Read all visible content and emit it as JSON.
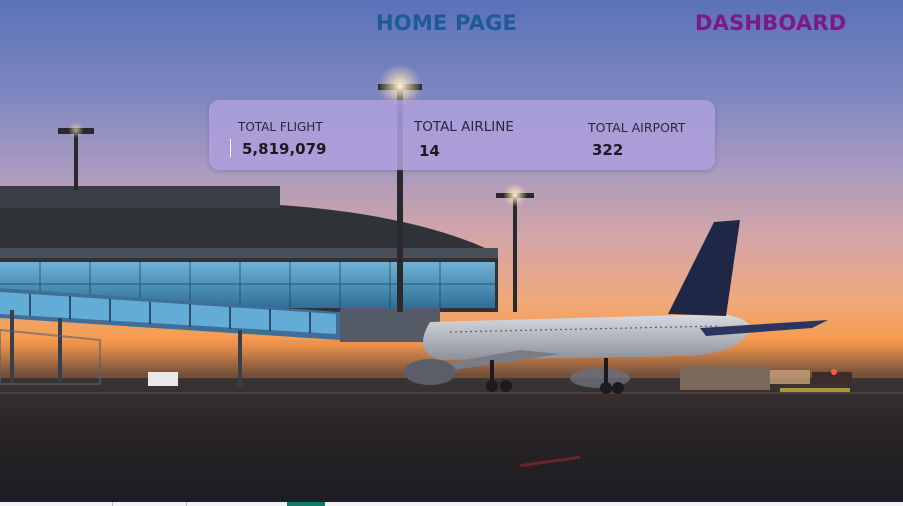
{
  "nav": {
    "home_label": "HOME PAGE",
    "dashboard_label": "DASHBOARD"
  },
  "kpis": [
    {
      "label": "TOTAL FLIGHT",
      "value": "5,819,079"
    },
    {
      "label": "TOTAL AIRLINE",
      "value": "14"
    },
    {
      "label": "TOTAL AIRPORT",
      "value": "322"
    }
  ],
  "colors": {
    "home_link": "#1e5a98",
    "dashboard_link": "#7b1a86",
    "kpi_card": "#ada0dc",
    "active_page_marker": "#0f7b6c"
  },
  "background": {
    "icon": "airport-sunset-photo"
  }
}
